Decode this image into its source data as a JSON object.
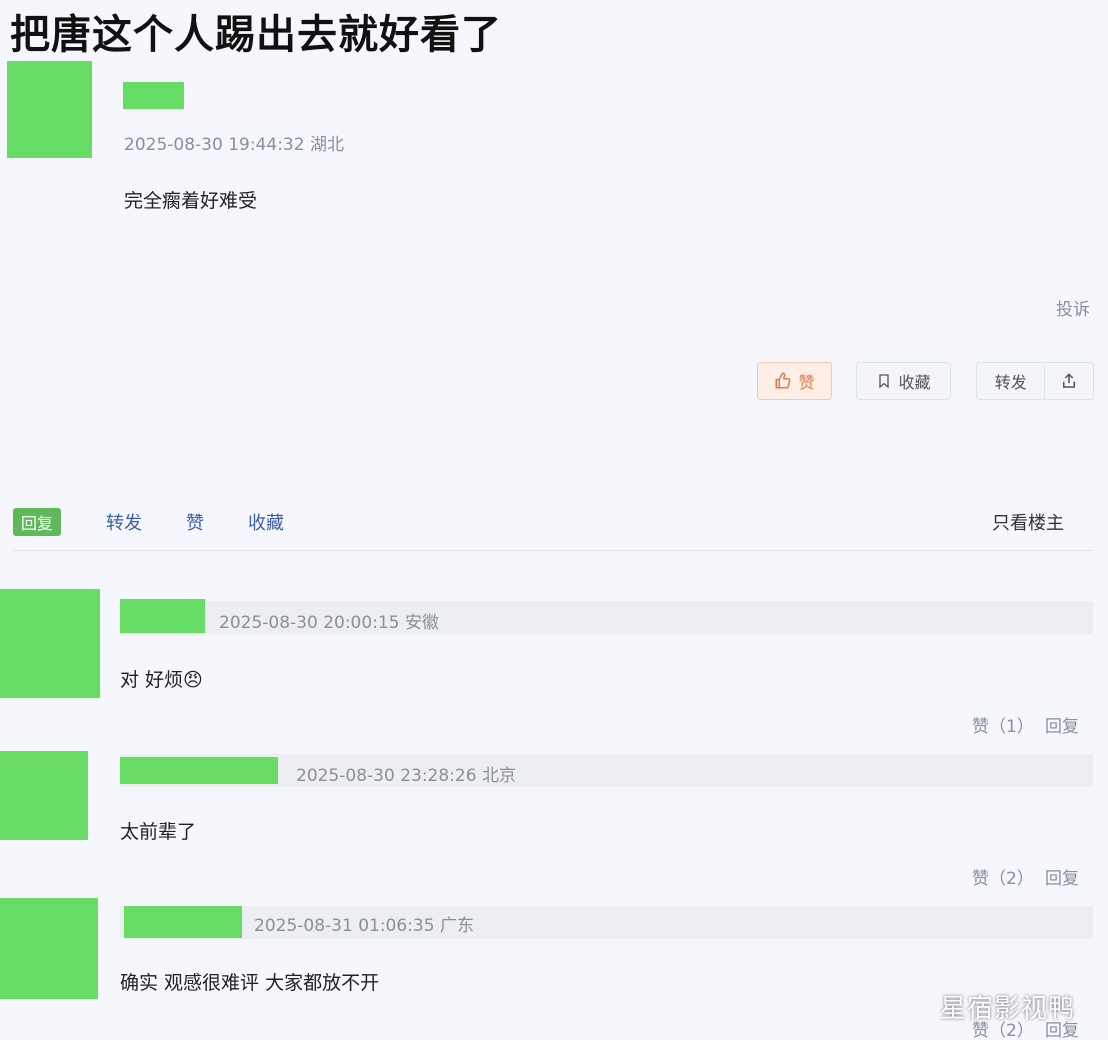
{
  "headline": "把唐这个人踢出去就好看了",
  "post": {
    "timestamp": "2025-08-30 19:44:32 湖北",
    "content": "完全瘸着好难受",
    "report_label": "投诉",
    "buttons": {
      "like": "赞",
      "favorite": "收藏",
      "forward": "转发"
    }
  },
  "tabs": {
    "reply": "回复",
    "forward": "转发",
    "like": "赞",
    "favorite": "收藏",
    "only_op": "只看楼主"
  },
  "replies": [
    {
      "timestamp": "2025-08-30 20:00:15 安徽",
      "content": "对 好烦😠",
      "like_label": "赞（1）",
      "reply_label": "回复"
    },
    {
      "timestamp": "2025-08-30 23:28:26 北京",
      "content": "太前辈了",
      "like_label": "赞（2）",
      "reply_label": "回复"
    },
    {
      "timestamp": "2025-08-31 01:06:35 广东",
      "content": "确实 观感很难评 大家都放不开",
      "like_label": "赞（2）",
      "reply_label": "回复"
    }
  ],
  "watermark": "星宿影视鸭",
  "colors": {
    "censor": "#67dd66",
    "like_accent": "#e07a4a",
    "tab_active": "#5fb85a",
    "link": "#3a5fa8"
  }
}
